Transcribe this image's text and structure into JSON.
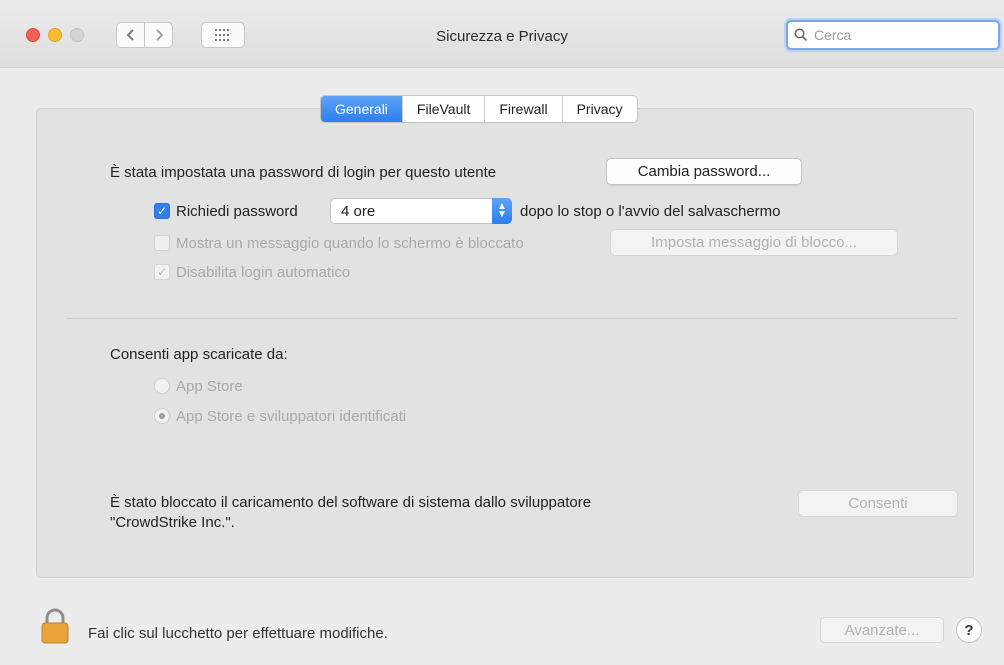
{
  "window": {
    "title": "Sicurezza e Privacy"
  },
  "search": {
    "placeholder": "Cerca",
    "value": ""
  },
  "toolbar": {
    "back_icon": "chevron-left-icon",
    "forward_icon": "chevron-right-icon",
    "grid_icon": "grid-icon"
  },
  "tabs": [
    {
      "label": "Generali",
      "active": true
    },
    {
      "label": "FileVault",
      "active": false
    },
    {
      "label": "Firewall",
      "active": false
    },
    {
      "label": "Privacy",
      "active": false
    }
  ],
  "general": {
    "password_text": "È stata impostata una password di login per questo utente",
    "change_password_button": "Cambia password...",
    "require_password": {
      "label": "Richiedi password",
      "checked": true,
      "selected": "4 ore",
      "suffix": "dopo lo stop o l'avvio del salvaschermo"
    },
    "show_message": {
      "label": "Mostra un messaggio quando lo schermo è bloccato",
      "checked": false,
      "enabled": false
    },
    "set_message_button": "Imposta messaggio di blocco...",
    "disable_autologin": {
      "label": "Disabilita login automatico",
      "checked": true,
      "enabled": false
    }
  },
  "apps": {
    "title": "Consenti app scaricate da:",
    "options": [
      {
        "label": "App Store",
        "selected": false
      },
      {
        "label": "App Store e sviluppatori identificati",
        "selected": true
      }
    ]
  },
  "blocked": {
    "text_line1": "È stato bloccato il caricamento del software di sistema dallo sviluppatore",
    "text_line2": "\"CrowdStrike Inc.\".",
    "allow_button": "Consenti"
  },
  "footer": {
    "lock_text": "Fai clic sul lucchetto per effettuare modifiche.",
    "advanced_button": "Avanzate...",
    "help_button": "?"
  },
  "colors": {
    "accent": "#2f80ed",
    "close": "#f25f58",
    "minimize": "#f8bd30",
    "lock": "#e8a33a"
  }
}
